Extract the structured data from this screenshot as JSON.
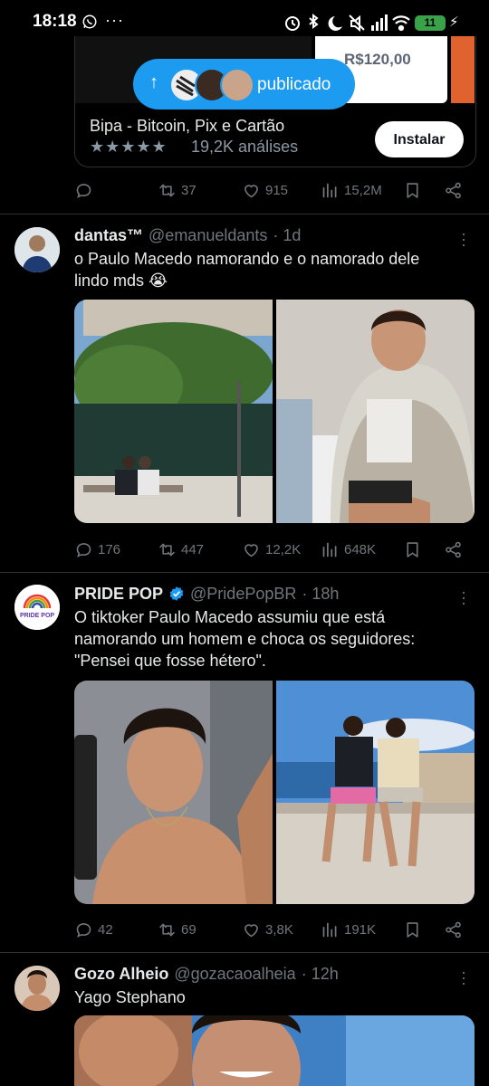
{
  "status_bar": {
    "time": "18:18",
    "dots": "···",
    "battery": "11"
  },
  "ad": {
    "price": "R$120,00",
    "title": "Bipa - Bitcoin, Pix e Cartão",
    "stars": "★★★★★",
    "reviews": "19,2K análises",
    "install_label": "Instalar",
    "actions": {
      "retweets": "37",
      "likes": "915",
      "views": "15,2M"
    }
  },
  "pill": {
    "arrow": "↑",
    "label": "publicado"
  },
  "tweets": [
    {
      "name": "dantas™",
      "handle": "@emanueldants",
      "time": "· 1d",
      "text_line1": "o Paulo Macedo namorando e o namorado dele",
      "text_line2": "lindo mds 😭",
      "actions": {
        "replies": "176",
        "retweets": "447",
        "likes": "12,2K",
        "views": "648K"
      }
    },
    {
      "name": "PRIDE POP",
      "handle": "@PridePopBR",
      "time": "· 18h",
      "avatar_text": "PRIDE POP",
      "text_line1": "O tiktoker Paulo Macedo assumiu que está",
      "text_line2": "namorando um homem e choca os seguidores:",
      "text_line3": "\"Pensei que fosse hétero\".",
      "actions": {
        "replies": "42",
        "retweets": "69",
        "likes": "3,8K",
        "views": "191K"
      }
    },
    {
      "name": "Gozo Alheio",
      "handle": "@gozacaoalheia",
      "time": "· 12h",
      "text_line1": "Yago Stephano"
    }
  ],
  "colors": {
    "background": "#000000",
    "accent": "#1d9bf0",
    "muted": "#71767b",
    "divider": "#2f3336"
  },
  "icons": [
    "reply-icon",
    "retweet-icon",
    "like-icon",
    "views-icon",
    "bookmark-icon",
    "share-icon",
    "verified-icon",
    "more-icon"
  ]
}
